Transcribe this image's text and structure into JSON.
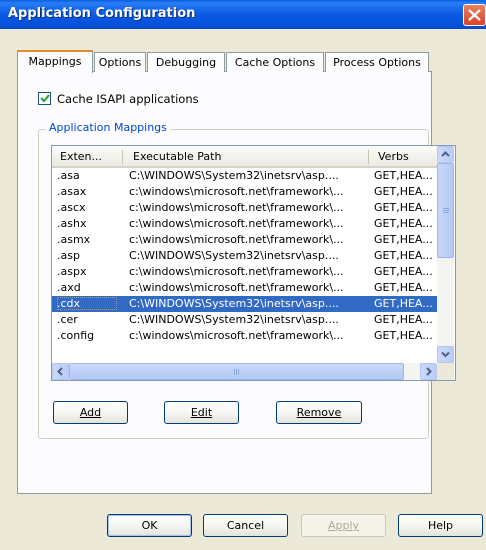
{
  "window": {
    "title": "Application Configuration"
  },
  "tabs": [
    {
      "label": "Mappings",
      "active": true
    },
    {
      "label": "Options"
    },
    {
      "label": "Debugging"
    },
    {
      "label": "Cache Options"
    },
    {
      "label": "Process Options"
    }
  ],
  "checkbox": {
    "label": "Cache ISAPI applications",
    "checked": true
  },
  "group": {
    "label": "Application Mappings"
  },
  "columns": [
    "Exten...",
    "Executable Path",
    "Verbs"
  ],
  "rows": [
    {
      "ext": ".asa",
      "path": "C:\\WINDOWS\\System32\\inetsrv\\asp....",
      "verbs": "GET,HEA..."
    },
    {
      "ext": ".asax",
      "path": "c:\\windows\\microsoft.net\\framework\\...",
      "verbs": "GET,HEA..."
    },
    {
      "ext": ".ascx",
      "path": "c:\\windows\\microsoft.net\\framework\\...",
      "verbs": "GET,HEA..."
    },
    {
      "ext": ".ashx",
      "path": "c:\\windows\\microsoft.net\\framework\\...",
      "verbs": "GET,HEA..."
    },
    {
      "ext": ".asmx",
      "path": "c:\\windows\\microsoft.net\\framework\\...",
      "verbs": "GET,HEA..."
    },
    {
      "ext": ".asp",
      "path": "C:\\WINDOWS\\System32\\inetsrv\\asp....",
      "verbs": "GET,HEA..."
    },
    {
      "ext": ".aspx",
      "path": "c:\\windows\\microsoft.net\\framework\\...",
      "verbs": "GET,HEA..."
    },
    {
      "ext": ".axd",
      "path": "c:\\windows\\microsoft.net\\framework\\...",
      "verbs": "GET,HEA..."
    },
    {
      "ext": ".cdx",
      "path": "C:\\WINDOWS\\System32\\inetsrv\\asp....",
      "verbs": "GET,HEA...",
      "selected": true
    },
    {
      "ext": ".cer",
      "path": "C:\\WINDOWS\\System32\\inetsrv\\asp....",
      "verbs": "GET,HEA..."
    },
    {
      "ext": ".config",
      "path": "c:\\windows\\microsoft.net\\framework\\...",
      "verbs": "GET,HEA..."
    }
  ],
  "list_buttons": {
    "add": "Add",
    "edit": "Edit",
    "remove": "Remove"
  },
  "dialog_buttons": {
    "ok": "OK",
    "cancel": "Cancel",
    "apply": "Apply",
    "help": "Help"
  },
  "colors": {
    "titlebar": "#0a5fe0",
    "selection": "#316ac5",
    "group_label": "#0046d5",
    "active_tab_accent": "#e68b2c"
  }
}
